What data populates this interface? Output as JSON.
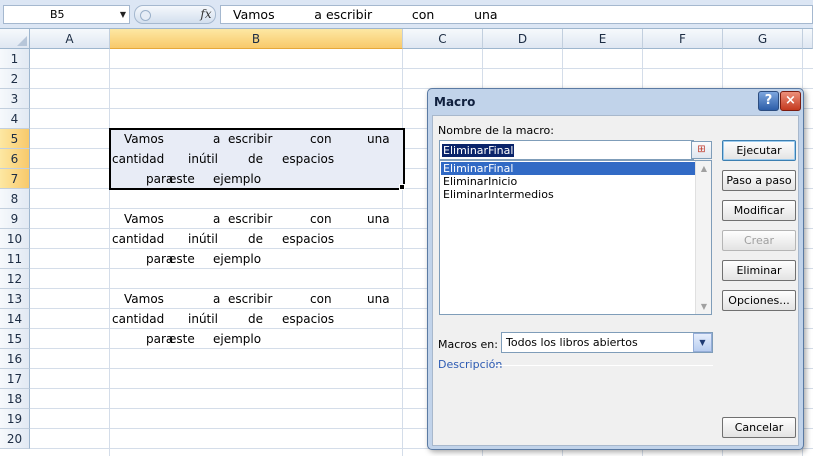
{
  "formula_bar": {
    "name_box": "B5",
    "fx": "fx",
    "formula": "Vamos          a escribir          con          una"
  },
  "columns": [
    "A",
    "B",
    "C",
    "D",
    "E",
    "F",
    "G"
  ],
  "selected_column": "B",
  "rows": [
    "1",
    "2",
    "3",
    "4",
    "5",
    "6",
    "7",
    "8",
    "9",
    "10",
    "11",
    "12",
    "13",
    "14",
    "15",
    "16",
    "17",
    "18",
    "19",
    "20"
  ],
  "selected_rows": [
    "5",
    "6",
    "7"
  ],
  "cells": {
    "b5": [
      "Vamos",
      "a",
      "escribir",
      "con",
      "una"
    ],
    "b6": [
      "cantidad",
      "inútil",
      "de",
      "espacios"
    ],
    "b7": [
      "para",
      "este",
      "ejemplo"
    ],
    "b9": [
      "Vamos",
      "a",
      "escribir",
      "con",
      "una"
    ],
    "b10": [
      "cantidad",
      "inútil",
      "de",
      "espacios"
    ],
    "b11": [
      "para",
      "este",
      "ejemplo"
    ],
    "b13": [
      "Vamos",
      "a",
      "escribir",
      "con",
      "una"
    ],
    "b14": [
      "cantidad",
      "inútil",
      "de",
      "espacios"
    ],
    "b15": [
      "para",
      "este",
      "ejemplo"
    ]
  },
  "dialog": {
    "title": "Macro",
    "help": "?",
    "close": "×",
    "name_label": "Nombre de la macro:",
    "name_value": "EliminarFinal",
    "macros": [
      "EliminarFinal",
      "EliminarInicio",
      "EliminarIntermedios"
    ],
    "selected_index": 0,
    "buttons": {
      "run": "Ejecutar",
      "step": "Paso a paso",
      "edit": "Modificar",
      "create": "Crear",
      "delete": "Eliminar",
      "options": "Opciones...",
      "cancel": "Cancelar"
    },
    "macros_in_label": "Macros en:",
    "macros_in_value": "Todos los libros abiertos",
    "description_label": "Descripción",
    "description_text": ""
  },
  "colors": {
    "selection_header": "#f8c96b",
    "list_highlight": "#316ac5",
    "dialog_frame": "#c1d3ea"
  }
}
